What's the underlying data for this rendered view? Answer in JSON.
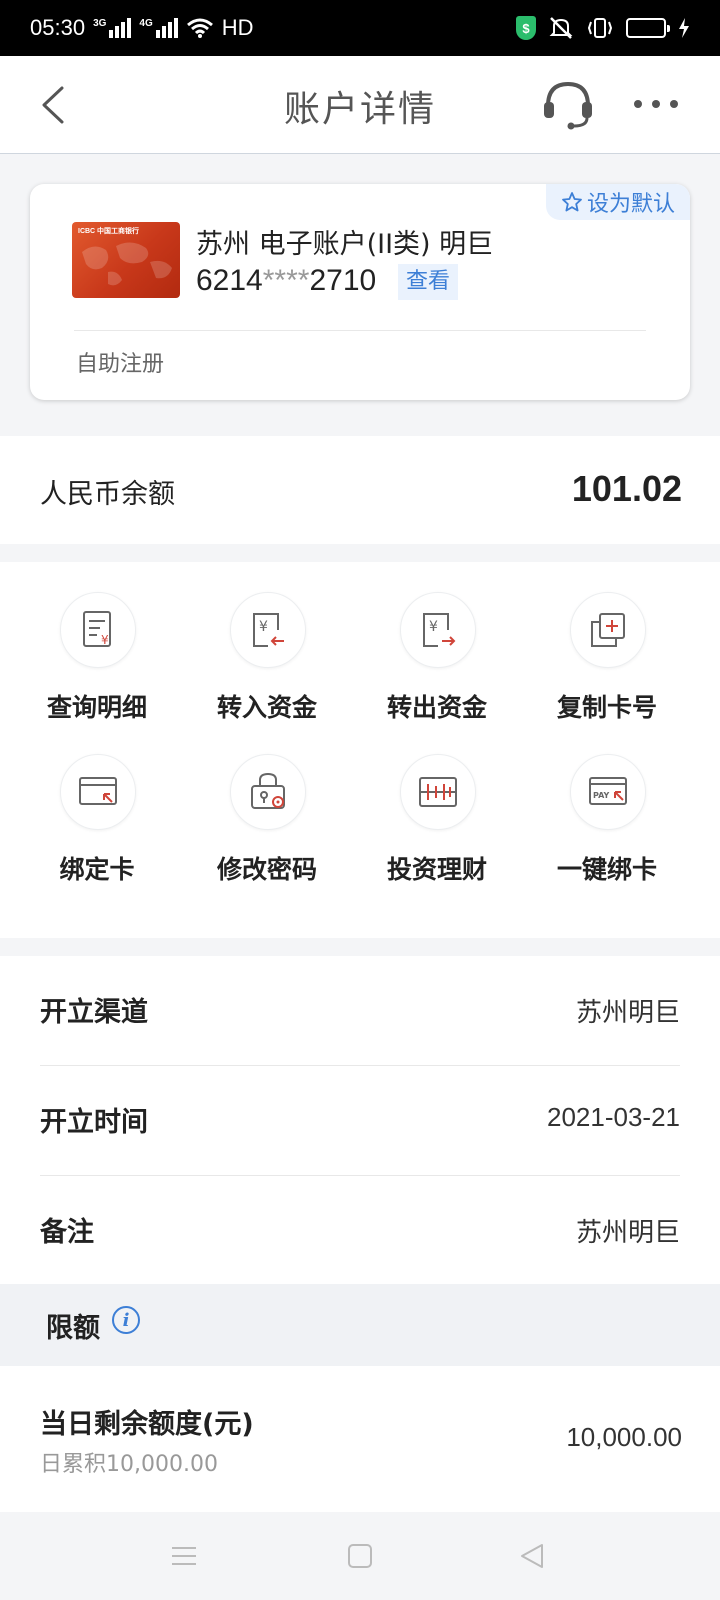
{
  "status_bar": {
    "time": "05:30",
    "net1": "3G",
    "net2": "4G",
    "hd": "HD",
    "shield_symbol": "$"
  },
  "header": {
    "title": "账户详情",
    "icons": [
      "back-icon",
      "headset-icon",
      "more-icon"
    ]
  },
  "card": {
    "default_label": "设为默认",
    "account_name": "苏州 电子账户(II类) 明巨",
    "number_prefix": "6214",
    "number_mask": "****",
    "number_suffix": "2710",
    "view_label": "查看",
    "register_label": "自助注册",
    "bank_logo_text": "ICBC 中国工商银行",
    "card_color": "#d4421f"
  },
  "balance": {
    "label": "人民币余额",
    "value": "101.02"
  },
  "functions": [
    {
      "label": "查询明细",
      "icon": "statement-icon"
    },
    {
      "label": "转入资金",
      "icon": "transfer-in-icon"
    },
    {
      "label": "转出资金",
      "icon": "transfer-out-icon"
    },
    {
      "label": "复制卡号",
      "icon": "copy-card-icon"
    },
    {
      "label": "绑定卡",
      "icon": "bind-card-icon"
    },
    {
      "label": "修改密码",
      "icon": "change-password-icon"
    },
    {
      "label": "投资理财",
      "icon": "invest-icon"
    },
    {
      "label": "一键绑卡",
      "icon": "quick-bind-icon"
    }
  ],
  "info": {
    "channel_label": "开立渠道",
    "channel_value": "苏州明巨",
    "time_label": "开立时间",
    "time_value": "2021-03-21",
    "remark_label": "备注",
    "remark_value": "苏州明巨"
  },
  "limits": {
    "title": "限额",
    "daily_label": "当日剩余额度(元)",
    "daily_sub": "日累积10,000.00",
    "daily_value": "10,000.00"
  },
  "colors": {
    "accent": "#3d7fd6",
    "icon_red": "#d0453a",
    "icon_gray": "#666666"
  }
}
